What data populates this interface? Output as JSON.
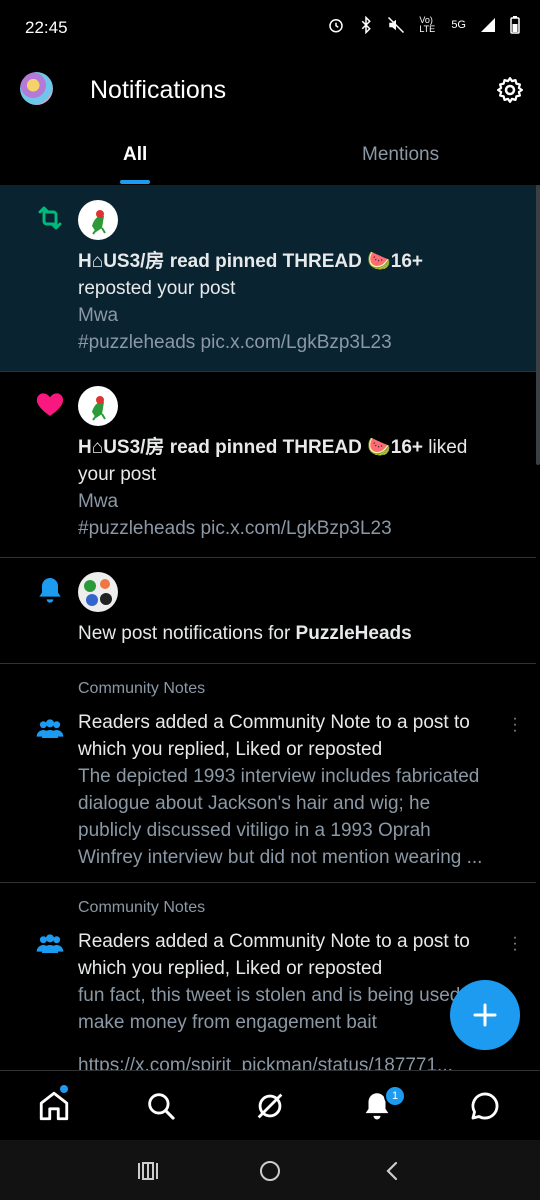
{
  "status_bar": {
    "time": "22:45",
    "network": "5G",
    "volte": "Vo) LTE"
  },
  "header": {
    "title": "Notifications"
  },
  "tabs": [
    {
      "label": "All",
      "active": true
    },
    {
      "label": "Mentions",
      "active": false
    }
  ],
  "notifications": [
    {
      "type": "repost",
      "icon": "repost-icon",
      "user": "H⌂US3/房 read pinned THREAD 🍉16+",
      "action": "reposted your post",
      "post_line1": "Mwa",
      "post_line2": "#puzzleheads pic.x.com/LgkBzp3L23"
    },
    {
      "type": "like",
      "icon": "heart-icon",
      "user": "H⌂US3/房 read pinned THREAD 🍉16+",
      "action": " liked",
      "action_line2": "your post",
      "post_line1": "Mwa",
      "post_line2": "#puzzleheads pic.x.com/LgkBzp3L23"
    },
    {
      "type": "post_notifications",
      "icon": "bell-icon",
      "text_prefix": "New post notifications for ",
      "account": "PuzzleHeads"
    },
    {
      "type": "community_note",
      "icon": "people-icon",
      "label": "Community Notes",
      "headline_line1": "Readers added a Community Note to a post to",
      "headline_line2": "which you replied, Liked or reposted",
      "body_line1": "The depicted 1993 interview includes fabricated",
      "body_line2": "dialogue about Jackson's hair and wig; he",
      "body_line3": "publicly discussed vitiligo in a 1993 Oprah",
      "body_line4": "Winfrey interview but did not mention wearing ..."
    },
    {
      "type": "community_note",
      "icon": "people-icon",
      "label": "Community Notes",
      "headline_line1": "Readers added a Community Note to a post to",
      "headline_line2": "which you replied, Liked or reposted",
      "body_line1": "fun fact, this tweet is stolen and is being used to",
      "body_line2": "make money from engagement bait",
      "body_line3": "https://x.com/spirit_pickman/status/187771..."
    }
  ],
  "bottom_nav": {
    "items": [
      "home-icon",
      "search-icon",
      "grok-icon",
      "notifications-icon",
      "messages-icon"
    ],
    "notifications_badge": "1"
  },
  "colors": {
    "accent": "#1d9bf0",
    "repost": "#00ba7c",
    "like": "#f91880",
    "highlight_bg": "#0a2330"
  }
}
